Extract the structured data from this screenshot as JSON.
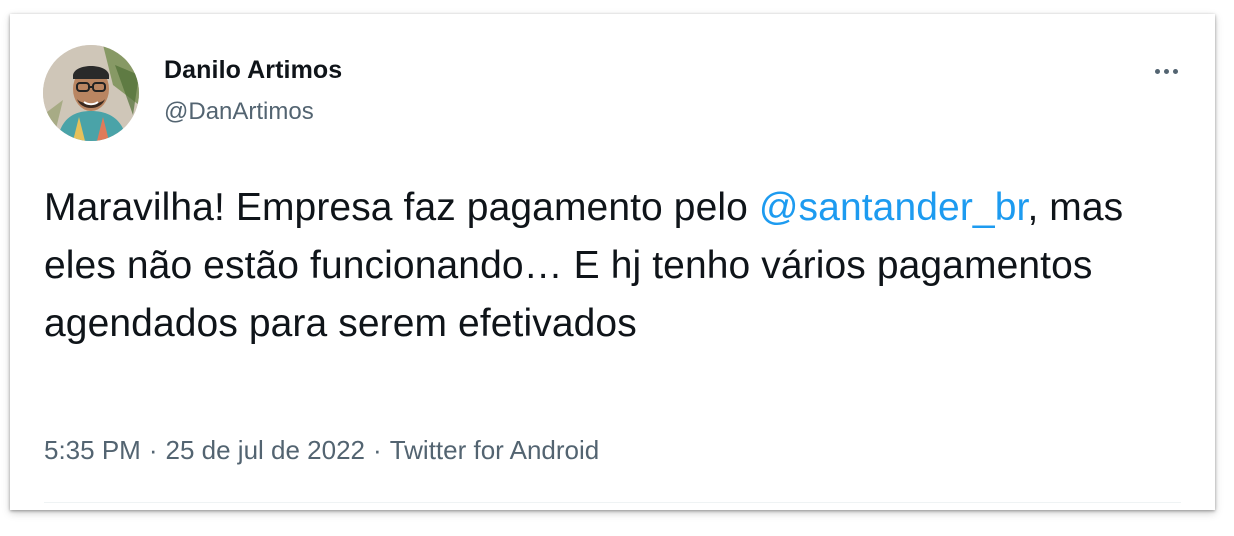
{
  "author": {
    "name": "Danilo Artimos",
    "handle": "@DanArtimos"
  },
  "tweet": {
    "text_before": "Maravilha! Empresa faz pagamento pelo ",
    "mention": "@santander_br",
    "text_after": ", mas eles não estão funcionando… E hj tenho vários pagamentos agendados para serem efetivados"
  },
  "meta": {
    "time": "5:35 PM",
    "date": "25 de jul de 2022",
    "source": "Twitter for Android",
    "separator": "·"
  },
  "icons": {
    "more": "more-options-icon",
    "avatar": "avatar"
  },
  "colors": {
    "text": "#0f1419",
    "secondary": "#536471",
    "link": "#1d9bf0"
  }
}
